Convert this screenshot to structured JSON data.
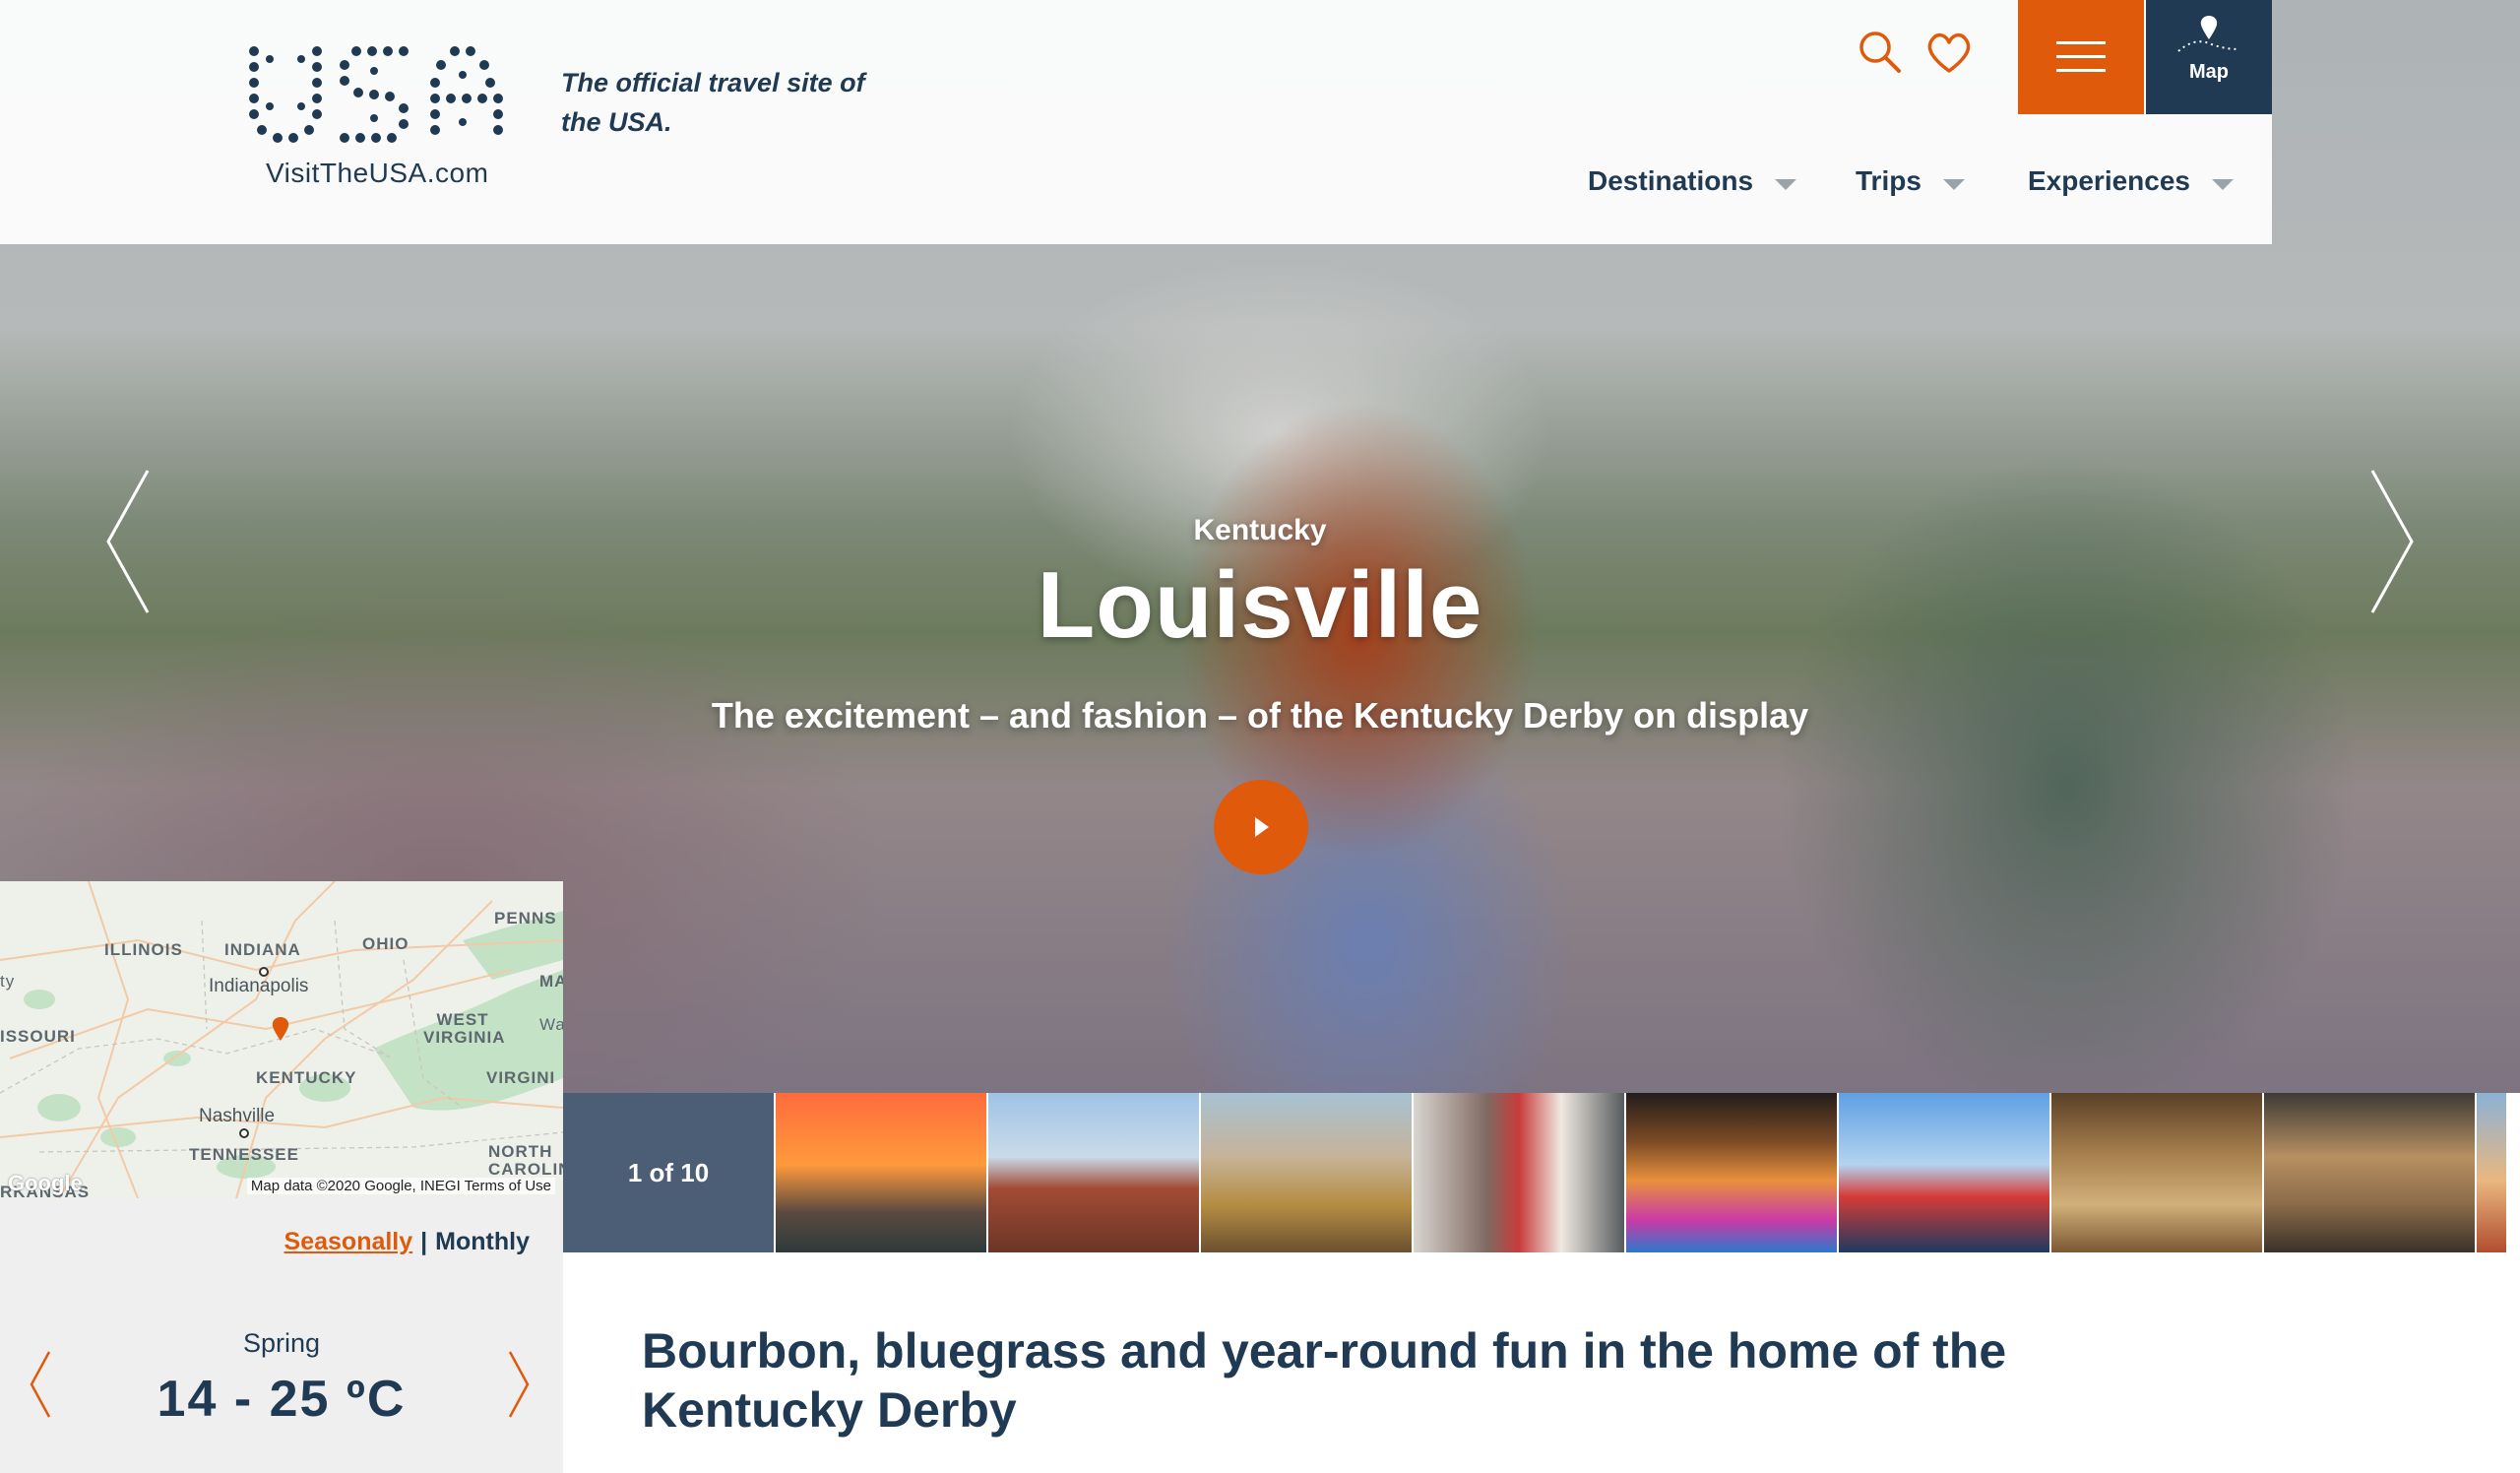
{
  "header": {
    "logo_text": "VisitTheUSA.com",
    "tagline": "The official travel site of the USA.",
    "map_label": "Map",
    "nav": [
      {
        "label": "Destinations"
      },
      {
        "label": "Trips"
      },
      {
        "label": "Experiences"
      }
    ]
  },
  "hero": {
    "region": "Kentucky",
    "title": "Louisville",
    "subtitle": "The excitement – and fashion – of the Kentucky Derby on display"
  },
  "gallery": {
    "counter": "1 of 10"
  },
  "map": {
    "labels": {
      "illinois": "ILLINOIS",
      "indiana": "INDIANA",
      "ohio": "OHIO",
      "penn": "PENNS",
      "ma": "MA",
      "missouri": "ISSOURI",
      "west_virginia": "WEST VIRGINIA",
      "kentucky": "KENTUCKY",
      "virginia": "VIRGINI",
      "tennessee": "TENNESSEE",
      "north_carolina": "NORTH CAROLINA",
      "arkansas": "RKANSAS",
      "wa": "Wa",
      "ty": "ty"
    },
    "cities": {
      "indianapolis": "Indianapolis",
      "nashville": "Nashville"
    },
    "google": "Google",
    "footer": "Map data ©2020 Google, INEGI",
    "terms": "Terms of Use"
  },
  "weather": {
    "toggle_seasonally": "Seasonally",
    "toggle_separator": "|",
    "toggle_monthly": "Monthly",
    "season": "Spring",
    "temp_range": "14 - 25 ºC"
  },
  "content": {
    "headline": "Bourbon, bluegrass and year-round fun in the home of the Kentucky Derby"
  },
  "colors": {
    "accent": "#e05a0c",
    "navy": "#1f3a52"
  },
  "icons": [
    "search-icon",
    "heart-icon",
    "hamburger-icon",
    "map-pin-icon",
    "chevron-left-icon",
    "chevron-right-icon",
    "play-icon",
    "caret-down-icon"
  ]
}
